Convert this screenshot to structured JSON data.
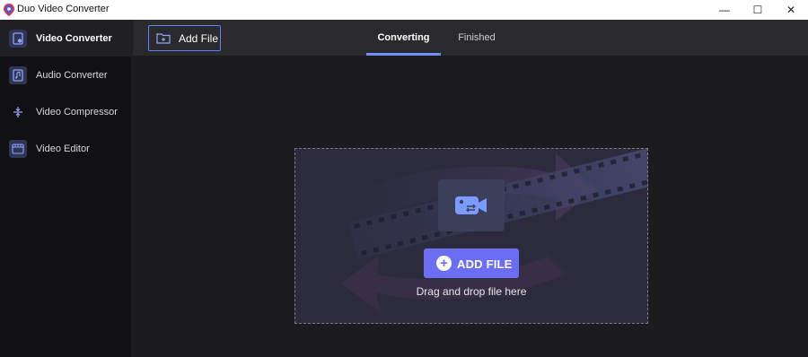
{
  "window": {
    "title": "Duo Video Converter",
    "controls": {
      "minimize": "—",
      "maximize": "☐",
      "close": "✕"
    }
  },
  "sidebar": {
    "items": [
      {
        "label": "Video Converter",
        "icon": "video-converter-icon",
        "active": true
      },
      {
        "label": "Audio Converter",
        "icon": "audio-converter-icon",
        "active": false
      },
      {
        "label": "Video Compressor",
        "icon": "video-compressor-icon",
        "active": false
      },
      {
        "label": "Video Editor",
        "icon": "video-editor-icon",
        "active": false
      }
    ]
  },
  "toolbar": {
    "add_file_label": "Add File",
    "add_file_icon": "folder-plus-icon"
  },
  "tabs": [
    {
      "label": "Converting",
      "active": true
    },
    {
      "label": "Finished",
      "active": false
    }
  ],
  "dropzone": {
    "button_label": "ADD FILE",
    "button_icon": "plus-circle-icon",
    "hint": "Drag and drop file here",
    "center_icon": "video-camera-convert-icon"
  },
  "colors": {
    "accent": "#6b6ef2",
    "tab_underline": "#6f8df5",
    "sidebar_bg": "#111113",
    "main_bg": "#1c1c1e",
    "dropzone_bg": "#2b2b3d"
  }
}
